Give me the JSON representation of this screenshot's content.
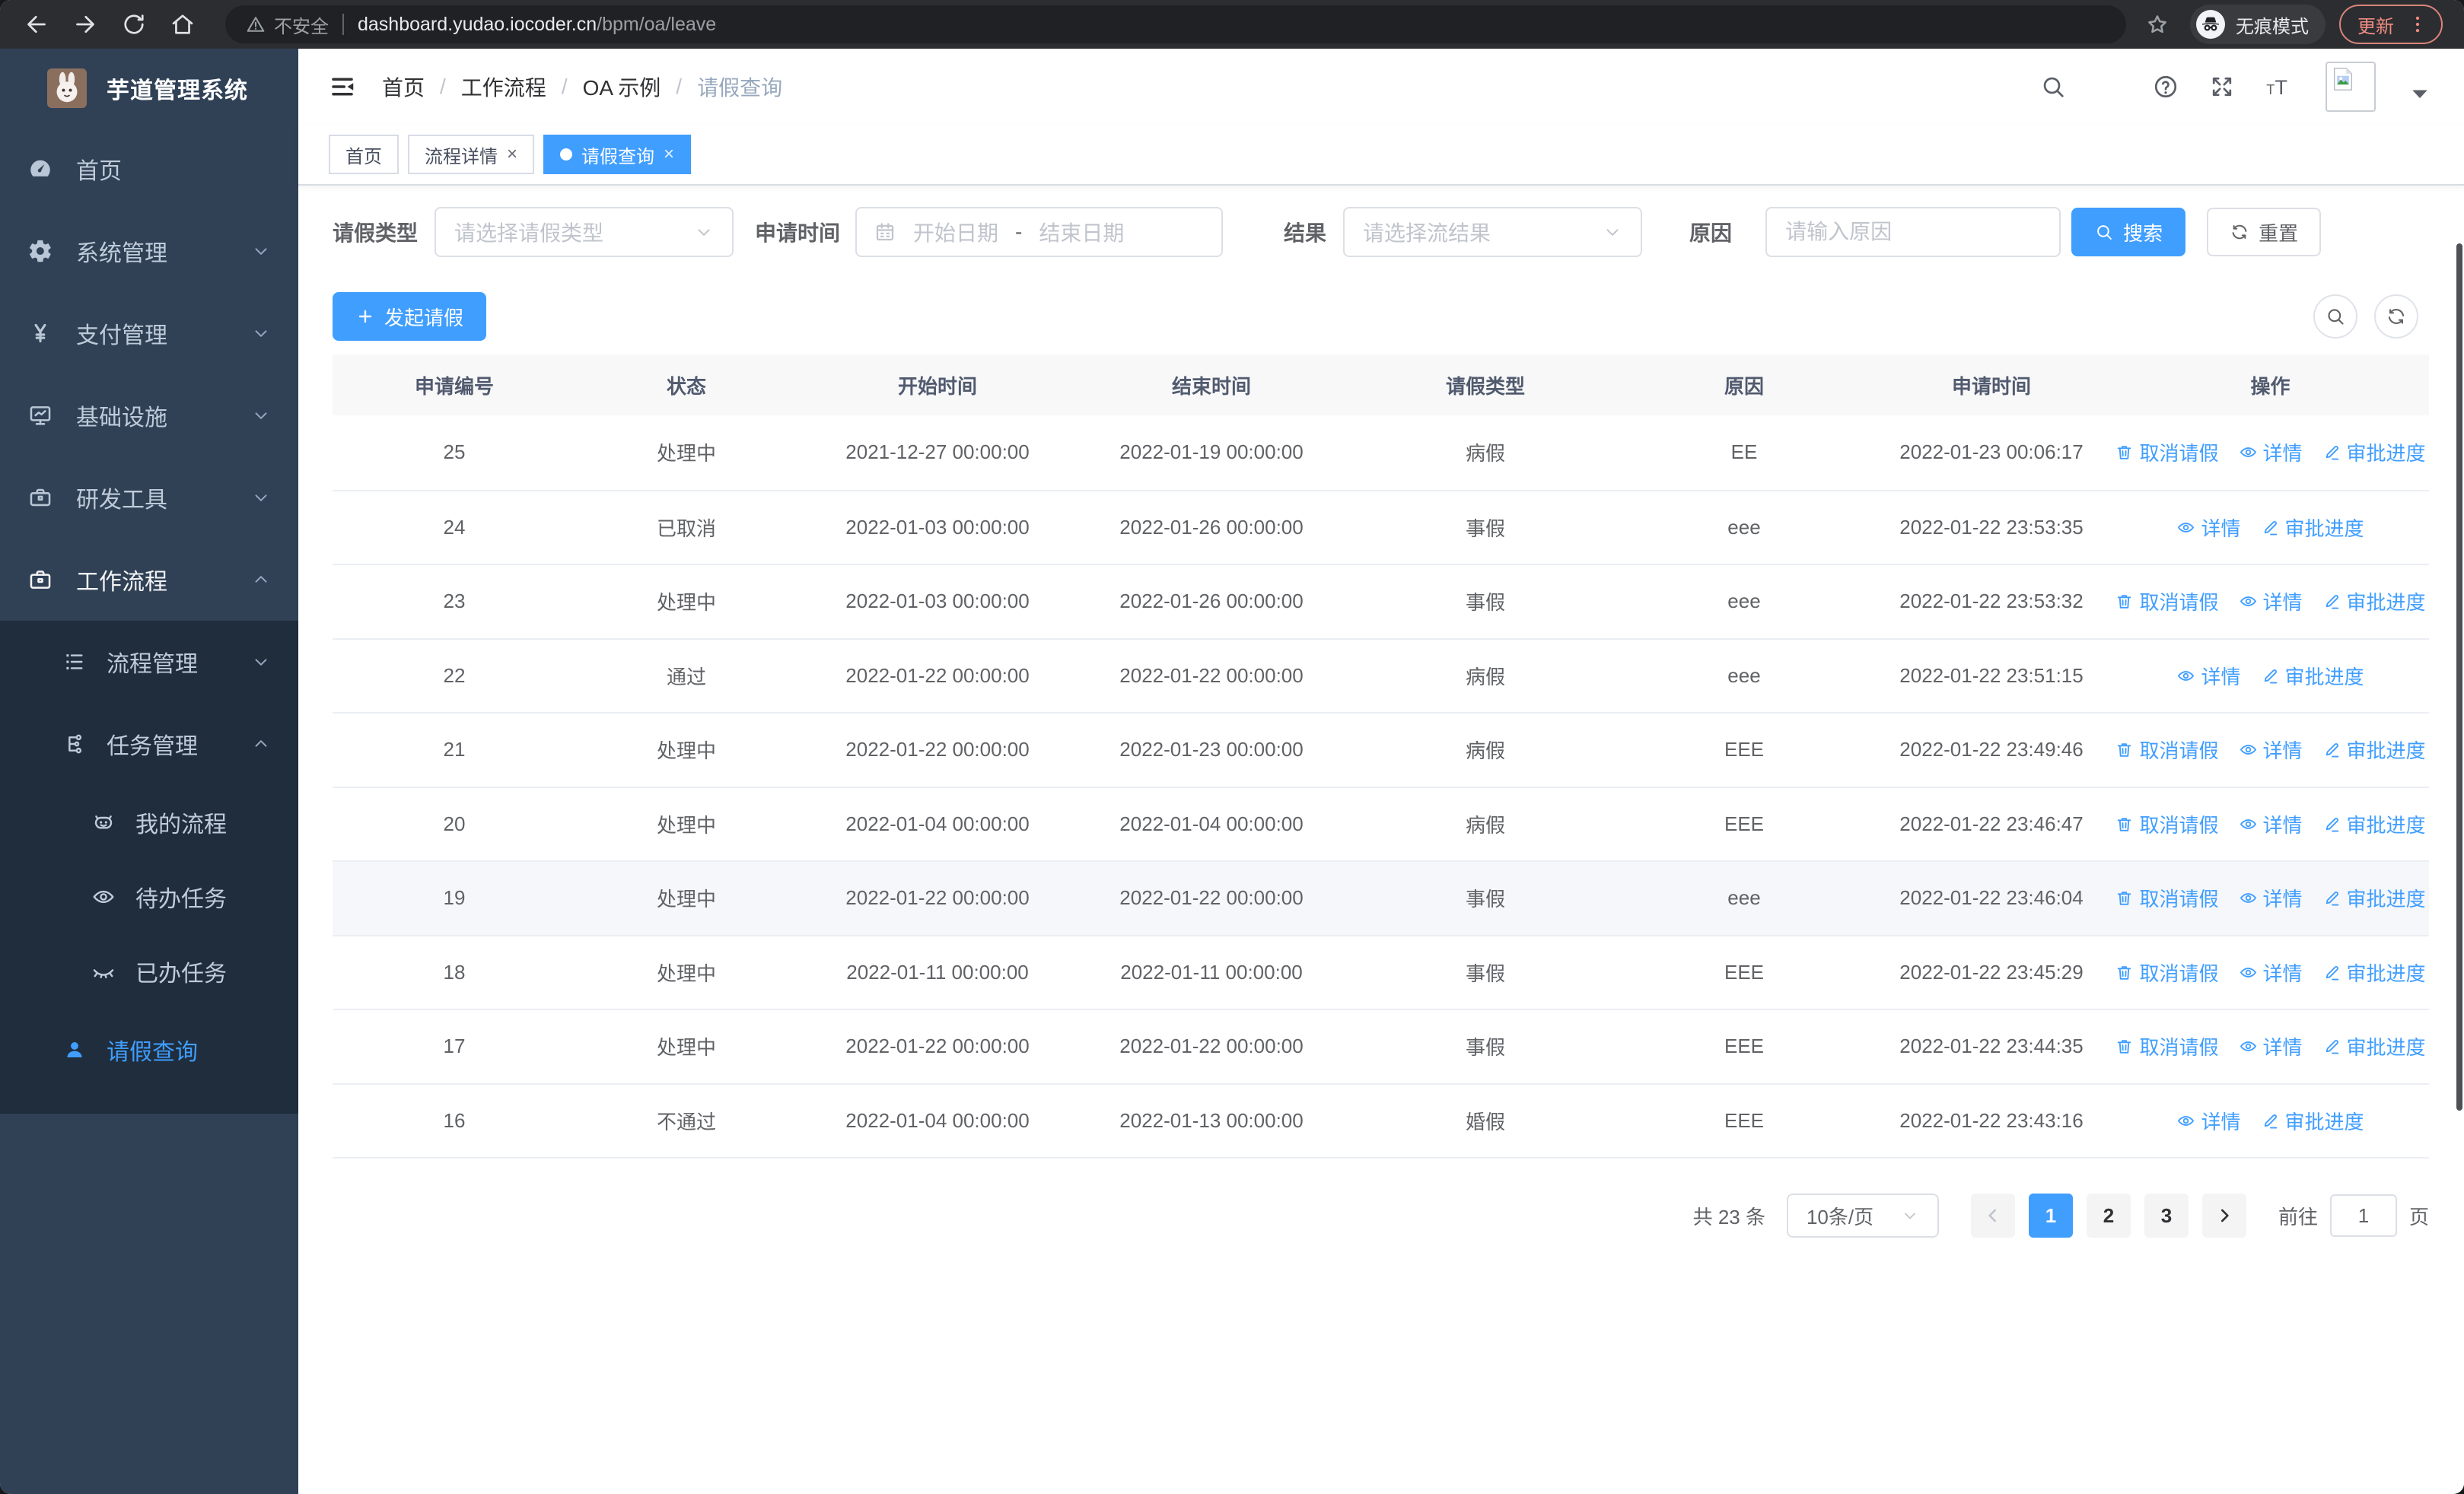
{
  "browser": {
    "security_label": "不安全",
    "url_host": "dashboard.yudao.iocoder.cn",
    "url_path": "/bpm/oa/leave",
    "incognito_label": "无痕模式",
    "update_label": "更新"
  },
  "sidebar": {
    "app_title": "芋道管理系统",
    "items": [
      {
        "label": "首页",
        "icon": "dashboard"
      },
      {
        "label": "系统管理",
        "icon": "gear",
        "chevron": "down"
      },
      {
        "label": "支付管理",
        "icon": "yen",
        "chevron": "down"
      },
      {
        "label": "基础设施",
        "icon": "monitor",
        "chevron": "down"
      },
      {
        "label": "研发工具",
        "icon": "toolbox",
        "chevron": "down"
      },
      {
        "label": "工作流程",
        "icon": "briefcase",
        "chevron": "up",
        "active": true
      }
    ],
    "submenu": [
      {
        "label": "流程管理",
        "icon": "list",
        "chevron": "down",
        "level": 1
      },
      {
        "label": "任务管理",
        "icon": "flow",
        "chevron": "up",
        "level": 1
      },
      {
        "label": "我的流程",
        "icon": "robot",
        "level": 2
      },
      {
        "label": "待办任务",
        "icon": "eye-open",
        "level": 2
      },
      {
        "label": "已办任务",
        "icon": "eye-closed",
        "level": 2
      },
      {
        "label": "请假查询",
        "icon": "user",
        "level": 1,
        "active": true
      }
    ]
  },
  "header": {
    "breadcrumb": [
      "首页",
      "工作流程",
      "OA 示例",
      "请假查询"
    ],
    "tabs": [
      {
        "label": "首页",
        "closable": false,
        "active": false
      },
      {
        "label": "流程详情",
        "closable": true,
        "active": false
      },
      {
        "label": "请假查询",
        "closable": true,
        "active": true
      }
    ],
    "toolbar_icons": [
      "search",
      "github",
      "help",
      "fullscreen",
      "font-size"
    ]
  },
  "filters": {
    "leave_type_label": "请假类型",
    "leave_type_placeholder": "请选择请假类型",
    "apply_time_label": "申请时间",
    "date_start_placeholder": "开始日期",
    "date_separator": "-",
    "date_end_placeholder": "结束日期",
    "result_label": "结果",
    "result_placeholder": "请选择流结果",
    "reason_label": "原因",
    "reason_placeholder": "请输入原因",
    "search_label": "搜索",
    "reset_label": "重置"
  },
  "actions": {
    "create_label": "发起请假"
  },
  "table": {
    "columns": [
      "申请编号",
      "状态",
      "开始时间",
      "结束时间",
      "请假类型",
      "原因",
      "申请时间",
      "操作"
    ],
    "action_labels": {
      "cancel": "取消请假",
      "detail": "详情",
      "progress": "审批进度"
    },
    "rows": [
      {
        "id": "25",
        "status": "处理中",
        "start": "2021-12-27 00:00:00",
        "end": "2022-01-19 00:00:00",
        "type": "病假",
        "reason": "EE",
        "applied": "2022-01-23 00:06:17",
        "actions": [
          "cancel",
          "detail",
          "progress"
        ],
        "highlight": false
      },
      {
        "id": "24",
        "status": "已取消",
        "start": "2022-01-03 00:00:00",
        "end": "2022-01-26 00:00:00",
        "type": "事假",
        "reason": "eee",
        "applied": "2022-01-22 23:53:35",
        "actions": [
          "detail",
          "progress"
        ],
        "highlight": false
      },
      {
        "id": "23",
        "status": "处理中",
        "start": "2022-01-03 00:00:00",
        "end": "2022-01-26 00:00:00",
        "type": "事假",
        "reason": "eee",
        "applied": "2022-01-22 23:53:32",
        "actions": [
          "cancel",
          "detail",
          "progress"
        ],
        "highlight": false
      },
      {
        "id": "22",
        "status": "通过",
        "start": "2022-01-22 00:00:00",
        "end": "2022-01-22 00:00:00",
        "type": "病假",
        "reason": "eee",
        "applied": "2022-01-22 23:51:15",
        "actions": [
          "detail",
          "progress"
        ],
        "highlight": false
      },
      {
        "id": "21",
        "status": "处理中",
        "start": "2022-01-22 00:00:00",
        "end": "2022-01-23 00:00:00",
        "type": "病假",
        "reason": "EEE",
        "applied": "2022-01-22 23:49:46",
        "actions": [
          "cancel",
          "detail",
          "progress"
        ],
        "highlight": false
      },
      {
        "id": "20",
        "status": "处理中",
        "start": "2022-01-04 00:00:00",
        "end": "2022-01-04 00:00:00",
        "type": "病假",
        "reason": "EEE",
        "applied": "2022-01-22 23:46:47",
        "actions": [
          "cancel",
          "detail",
          "progress"
        ],
        "highlight": false
      },
      {
        "id": "19",
        "status": "处理中",
        "start": "2022-01-22 00:00:00",
        "end": "2022-01-22 00:00:00",
        "type": "事假",
        "reason": "eee",
        "applied": "2022-01-22 23:46:04",
        "actions": [
          "cancel",
          "detail",
          "progress"
        ],
        "highlight": true
      },
      {
        "id": "18",
        "status": "处理中",
        "start": "2022-01-11 00:00:00",
        "end": "2022-01-11 00:00:00",
        "type": "事假",
        "reason": "EEE",
        "applied": "2022-01-22 23:45:29",
        "actions": [
          "cancel",
          "detail",
          "progress"
        ],
        "highlight": false
      },
      {
        "id": "17",
        "status": "处理中",
        "start": "2022-01-22 00:00:00",
        "end": "2022-01-22 00:00:00",
        "type": "事假",
        "reason": "EEE",
        "applied": "2022-01-22 23:44:35",
        "actions": [
          "cancel",
          "detail",
          "progress"
        ],
        "highlight": false
      },
      {
        "id": "16",
        "status": "不通过",
        "start": "2022-01-04 00:00:00",
        "end": "2022-01-13 00:00:00",
        "type": "婚假",
        "reason": "EEE",
        "applied": "2022-01-22 23:43:16",
        "actions": [
          "detail",
          "progress"
        ],
        "highlight": false
      }
    ]
  },
  "pagination": {
    "total_label": "共 23 条",
    "page_size": "10条/页",
    "pages": [
      "1",
      "2",
      "3"
    ],
    "active_page": "1",
    "goto_label": "前往",
    "goto_value": "1",
    "goto_suffix": "页"
  },
  "colors": {
    "accent": "#409eff",
    "sidebar_bg": "#304156",
    "submenu_bg": "#1f2d3d",
    "table_header_bg": "#f8f8f9",
    "row_highlight": "#f5f7fa",
    "update_accent": "#ee8b80"
  }
}
